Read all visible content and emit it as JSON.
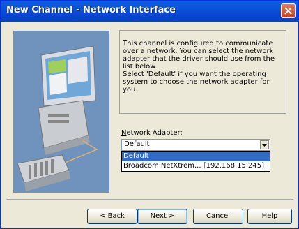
{
  "window": {
    "title": "New Channel - Network Interface"
  },
  "description": {
    "p1": "This channel is configured to communicate over a network.  You can select the network adapter that the driver should use from the list below.",
    "p2": "Select 'Default' if you want the operating system to choose the network adapter for you."
  },
  "adapter": {
    "label_pre": "",
    "label_accel": "N",
    "label_post": "etwork Adapter:",
    "selected_value": "Default",
    "options": [
      "Default",
      "Broadcom NetXtrem... [192.168.15.245]"
    ]
  },
  "buttons": {
    "back": "< Back",
    "next": "Next >",
    "cancel": "Cancel",
    "help": "Help"
  },
  "colors": {
    "titlebar": "#0846d3",
    "selection": "#316ac5",
    "illustration_bg": "#6b8fb8"
  }
}
